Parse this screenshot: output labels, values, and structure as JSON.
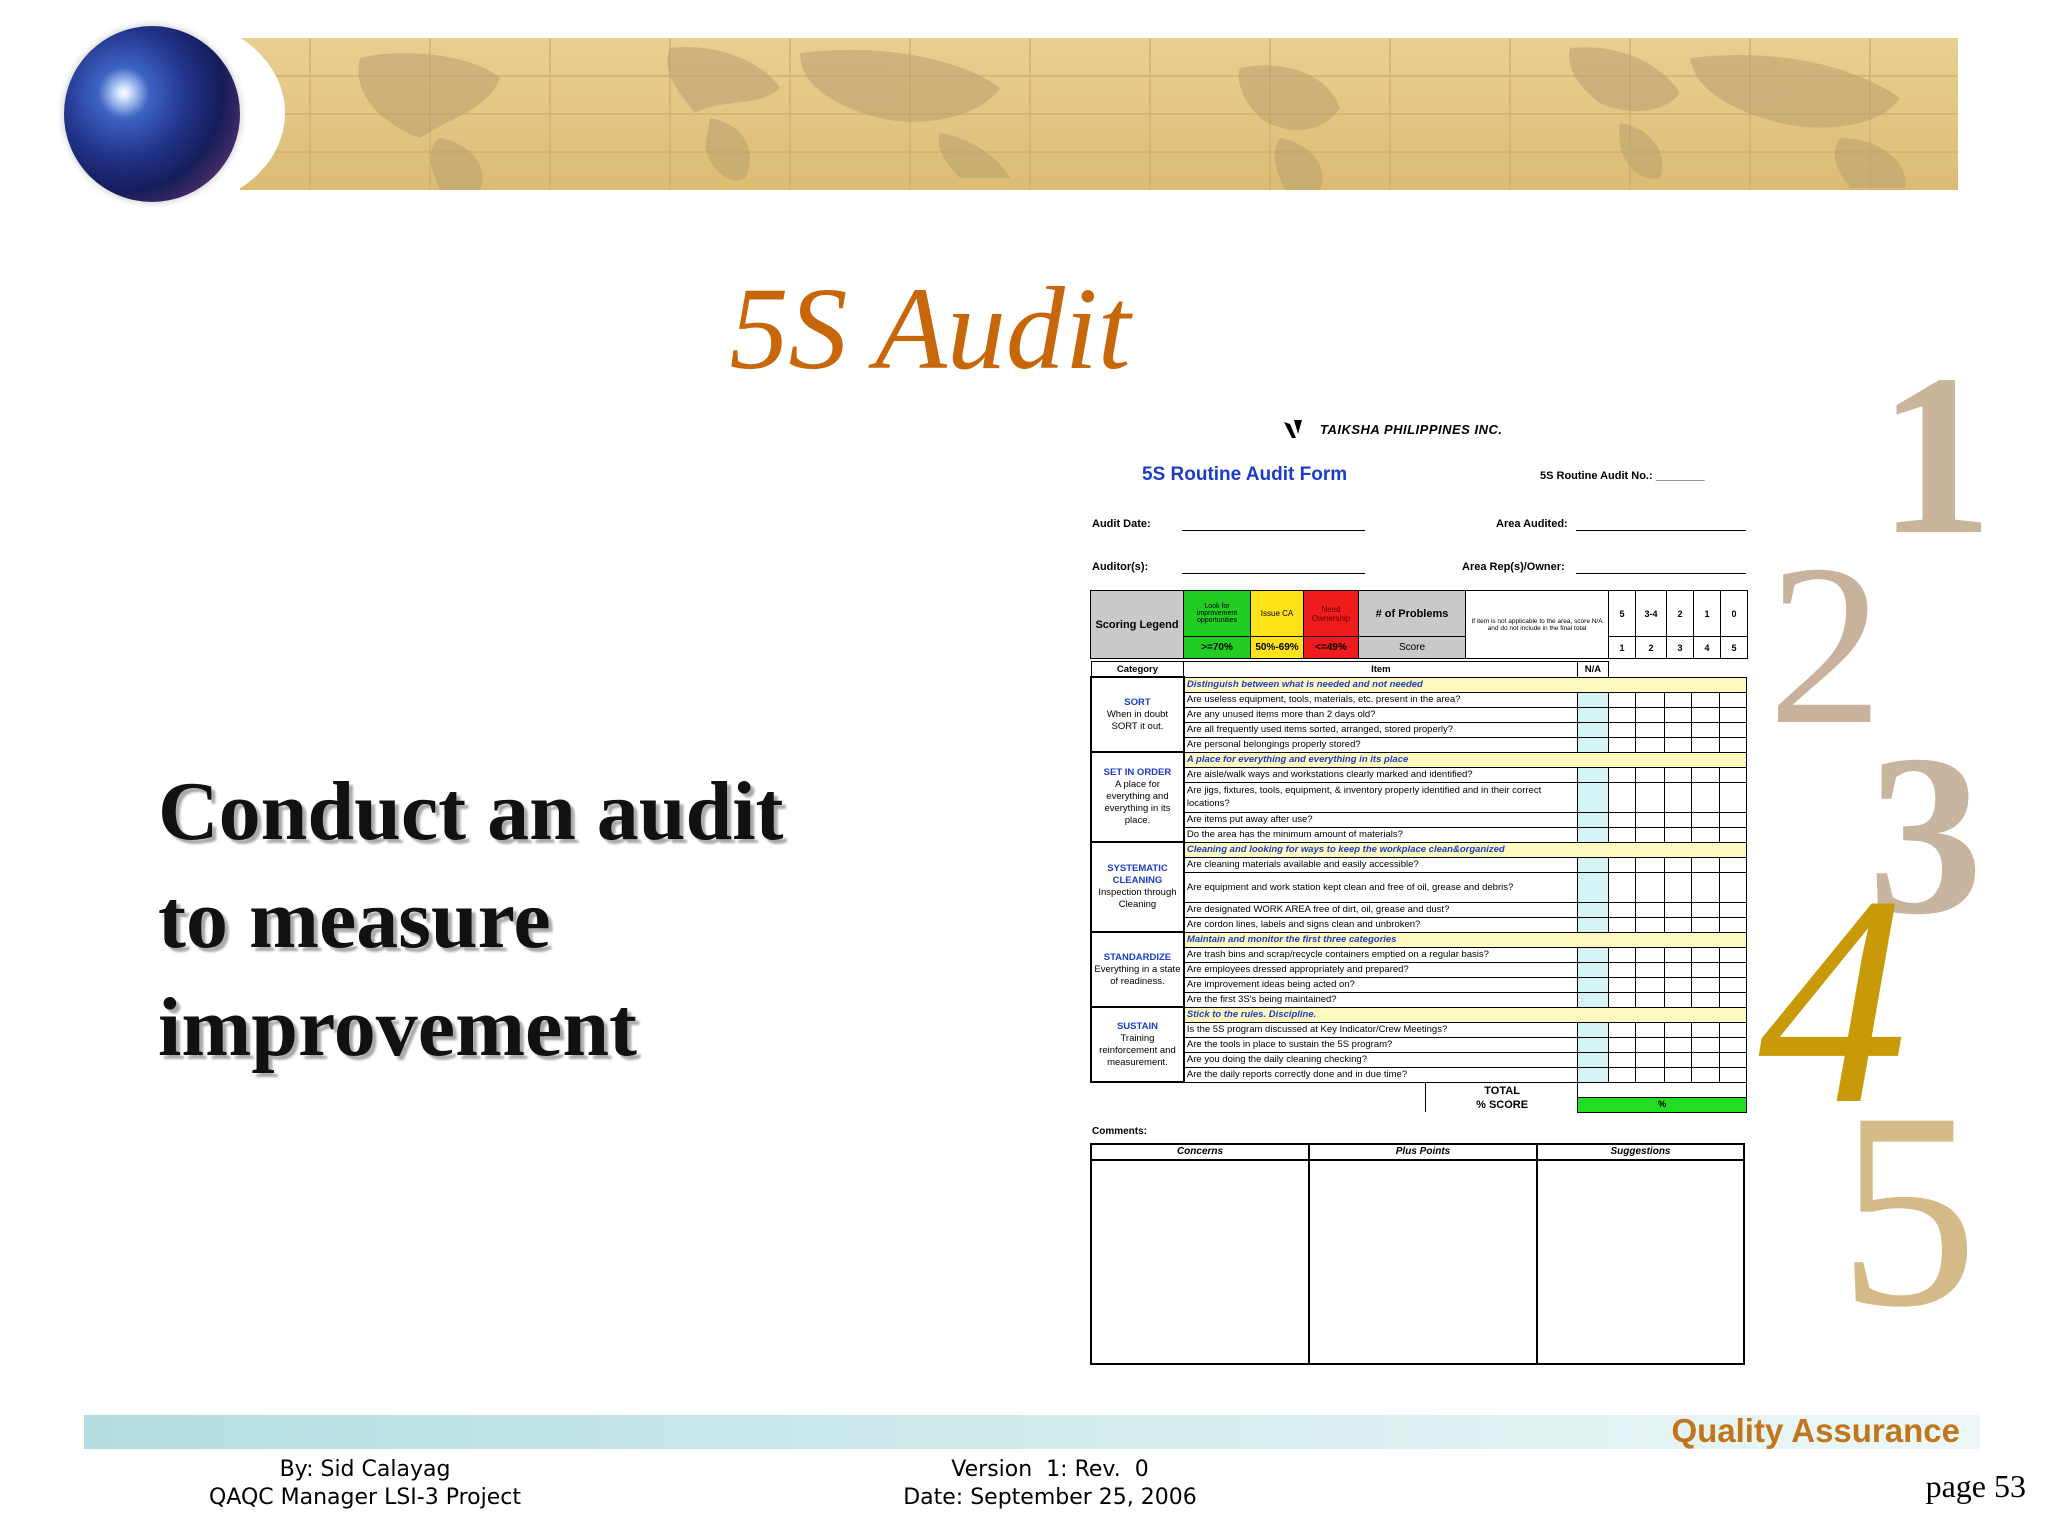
{
  "slide": {
    "title": "5S Audit",
    "main_text": [
      "Conduct an audit",
      "to measure",
      "improvement"
    ],
    "numbers": [
      "1",
      "2",
      "3",
      "4",
      "5"
    ]
  },
  "form": {
    "company": "TAIKSHA PHILIPPINES INC.",
    "title": "5S Routine Audit Form",
    "audit_no_label": "5S Routine Audit No.:",
    "audit_date_label": "Audit Date:",
    "area_audited_label": "Area Audited:",
    "auditors_label": "Auditor(s):",
    "area_rep_label": "Area Rep(s)/Owner:",
    "legend": {
      "label": "Scoring Legend",
      "green_label": "Look for improvement opportunities",
      "yellow_label": "Issue CA",
      "red_label": "Need Ownership",
      "green_range": ">=70%",
      "yellow_range": "50%-69%",
      "red_range": "<=49%",
      "problems_label": "# of Problems",
      "score_label": "Score",
      "na_note": "If item is not applicable to the area, score N/A and do not include in the final total",
      "problem_counts": [
        "5",
        "3-4",
        "2",
        "1",
        "0"
      ],
      "scores": [
        "1",
        "2",
        "3",
        "4",
        "5"
      ]
    },
    "headers": {
      "category": "Category",
      "item": "Item",
      "na": "N/A"
    },
    "sections": [
      {
        "name": "SORT",
        "desc": "When in doubt SORT it out.",
        "heading": "Distinguish between what is needed and not needed",
        "items": [
          "Are useless equipment, tools, materials, etc. present in the area?",
          "Are any unused items more than 2 days old?",
          "Are all frequently used items sorted, arranged, stored properly?",
          "Are personal belongings properly stored?"
        ]
      },
      {
        "name": "SET IN ORDER",
        "desc": "A place for everything and everything in its place.",
        "heading": "A place for everything and everything in its place",
        "items": [
          "Are aisle/walk ways and workstations clearly marked and identified?",
          "Are jigs, fixtures, tools, equipment, & inventory properly identified and in their correct locations?",
          "Are items put away after use?",
          "Do the area has the minimum amount of materials?"
        ]
      },
      {
        "name": "SYSTEMATIC CLEANING",
        "desc": "Inspection through Cleaning",
        "heading": "Cleaning and looking for ways to keep the workplace clean&organized",
        "items": [
          "Are cleaning materials available and easily accessible?",
          "Are equipment and work station kept clean and free of oil, grease and debris?",
          "Are designated WORK AREA free of dirt, oil, grease and dust?",
          "Are cordon lines, labels and signs clean and unbroken?"
        ]
      },
      {
        "name": "STANDARDIZE",
        "desc": "Everything in a state of readiness.",
        "heading": "Maintain and monitor the first three categories",
        "items": [
          "Are trash bins and scrap/recycle containers emptied on a regular basis?",
          "Are employees dressed appropriately and prepared?",
          "Are improvement ideas being acted on?",
          "Are the first 3S's being maintained?"
        ]
      },
      {
        "name": "SUSTAIN",
        "desc": "Training reinforcement and measurement.",
        "heading": "Stick to the rules. Discipline.",
        "items": [
          "Is the 5S program discussed at Key Indicator/Crew Meetings?",
          "Are the tools in place to sustain the 5S program?",
          "Are you doing the daily cleaning checking?",
          "Are the daily reports correctly done and in due time?"
        ]
      }
    ],
    "total_label": "TOTAL",
    "score_label": "% SCORE",
    "score_value": "%",
    "comments_label": "Comments:",
    "comment_columns": [
      "Concerns",
      "Plus Points",
      "Suggestions"
    ]
  },
  "footer": {
    "brand": "Quality Assurance",
    "author_line1": "By: Sid Calayag",
    "author_line2": "QAQC Manager LSI-3 Project",
    "version_line1": "Version  1: Rev.  0",
    "version_line2": "Date: September 25, 2006",
    "page": "page 53"
  },
  "colors": {
    "title": "#c8660a",
    "banner": "#e3c683",
    "legend_green": "#22cc22",
    "legend_yellow": "#ffe21a",
    "legend_red": "#ee1c1c",
    "score_green": "#22dd22",
    "qa_brand": "#c0761a"
  }
}
